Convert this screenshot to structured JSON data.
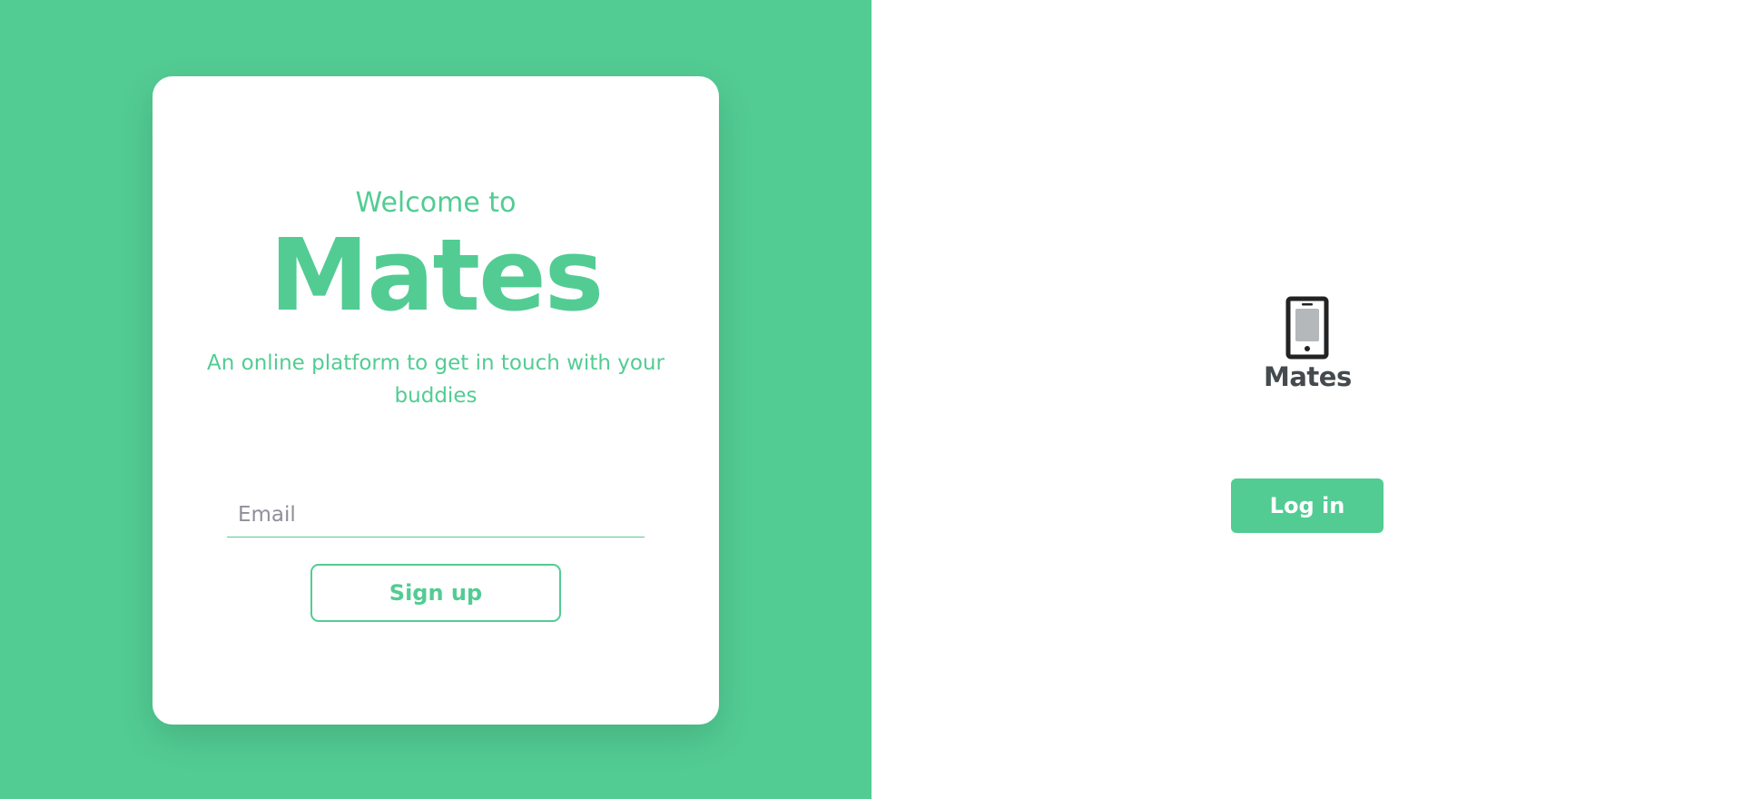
{
  "colors": {
    "brand_green": "#52cc93",
    "background_right": "#ffffff",
    "logo_text": "#444a4d",
    "placeholder": "#8f8f9b"
  },
  "signup_card": {
    "welcome_text": "Welcome to",
    "app_name": "Mates",
    "tagline": "An online platform to get in touch with your buddies",
    "email": {
      "value": "",
      "placeholder": "Email"
    },
    "signup_label": "Sign up"
  },
  "login_panel": {
    "logo": {
      "icon": "smartphone-icon",
      "text": "Mates"
    },
    "login_label": "Log in"
  }
}
